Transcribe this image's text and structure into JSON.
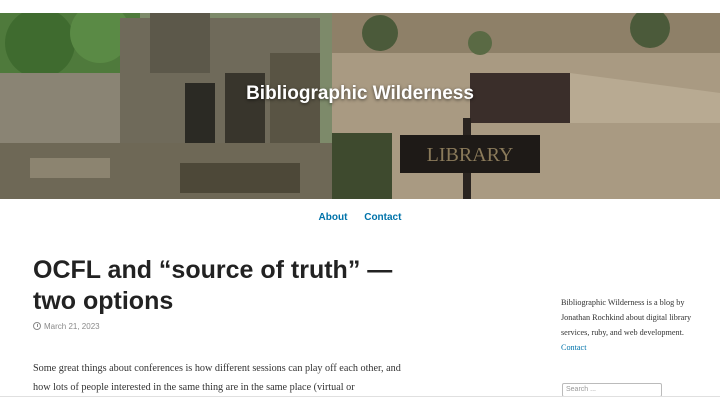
{
  "site": {
    "title": "Bibliographic Wilderness",
    "sign_text": "LIBRARY"
  },
  "menu": {
    "items": [
      {
        "label": "About"
      },
      {
        "label": "Contact"
      }
    ]
  },
  "post": {
    "title": "OCFL and “source of truth” — two options",
    "date": "March 21, 2023",
    "body": "Some great things about conferences is how different sessions can play off each other, and how lots of people interested in the same thing are in the same place (virtual or"
  },
  "sidebar": {
    "about_text": "Bibliographic Wilderness is a blog by Jonathan Rochkind about digital library services, ruby, and web development.",
    "contact_link": "Contact",
    "search_placeholder": "Search ..."
  },
  "colors": {
    "link": "#0073aa",
    "title_text": "#222222"
  },
  "icons": {
    "date": "clock-icon"
  }
}
